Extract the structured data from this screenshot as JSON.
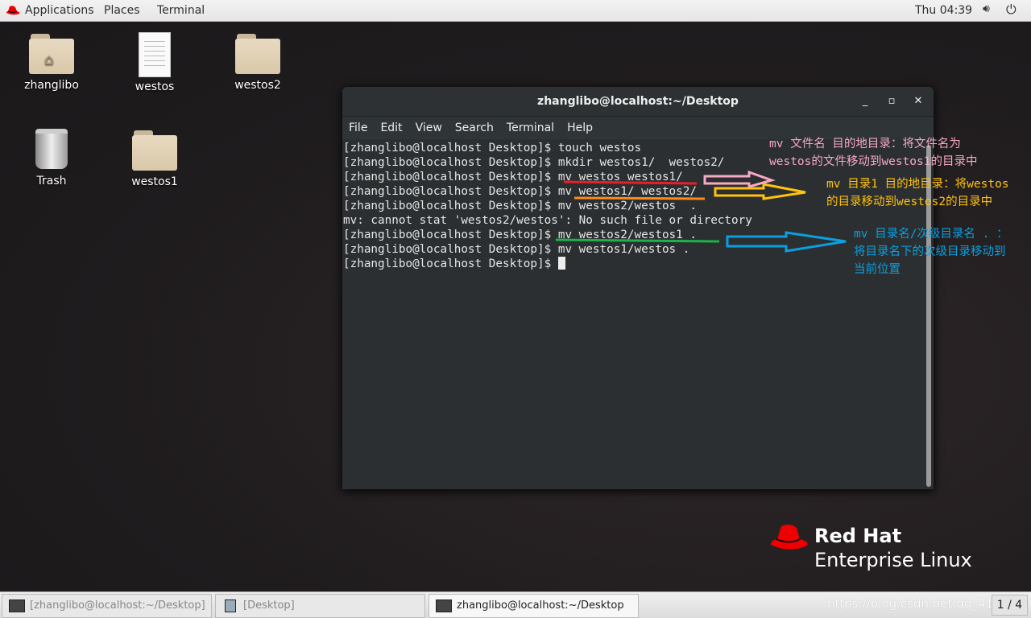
{
  "topbar": {
    "applications": "Applications",
    "places": "Places",
    "terminal": "Terminal",
    "clock": "Thu 04:39"
  },
  "desktop": {
    "icons": [
      {
        "label": "zhanglibo"
      },
      {
        "label": "westos"
      },
      {
        "label": "westos2"
      },
      {
        "label": "Trash"
      },
      {
        "label": "westos1"
      }
    ]
  },
  "terminal": {
    "title": "zhanglibo@localhost:~/Desktop",
    "menu": [
      "File",
      "Edit",
      "View",
      "Search",
      "Terminal",
      "Help"
    ],
    "lines": [
      "[zhanglibo@localhost Desktop]$ touch westos",
      "[zhanglibo@localhost Desktop]$ mkdir westos1/  westos2/",
      "[zhanglibo@localhost Desktop]$ mv westos westos1/",
      "[zhanglibo@localhost Desktop]$ mv westos1/ westos2/",
      "[zhanglibo@localhost Desktop]$ mv westos2/westos  .",
      "mv: cannot stat 'westos2/westos': No such file or directory",
      "[zhanglibo@localhost Desktop]$ mv westos2/westos1 .",
      "[zhanglibo@localhost Desktop]$ mv westos1/westos ."
    ],
    "prompt": "[zhanglibo@localhost Desktop]$ "
  },
  "annotations": [
    {
      "text": "mv 文件名 目的地目录：将文件名为\nwestos的文件移动到westos1的目录中",
      "color": "#f7a8c4"
    },
    {
      "text": "mv 目录1 目的地目录：将westos\n的目录移动到westos2的目录中",
      "color": "#ffc20e"
    },
    {
      "text": "mv 目录名/次级目录名 . ：\n将目录名下的次级目录移动到\n当前位置",
      "color": "#0aa0e0"
    }
  ],
  "colors": {
    "underline1": "#e8202a",
    "underline2": "#ff8a1c",
    "underline3": "#1cb34a"
  },
  "logo": {
    "line1": "Red Hat",
    "line2": "Enterprise Linux"
  },
  "taskbar": {
    "items": [
      "[zhanglibo@localhost:~/Desktop]",
      "[Desktop]",
      "zhanglibo@localhost:~/Desktop"
    ],
    "watermark": "https://blog.csdn.net/qq_41537102",
    "workspace": "1 / 4"
  }
}
